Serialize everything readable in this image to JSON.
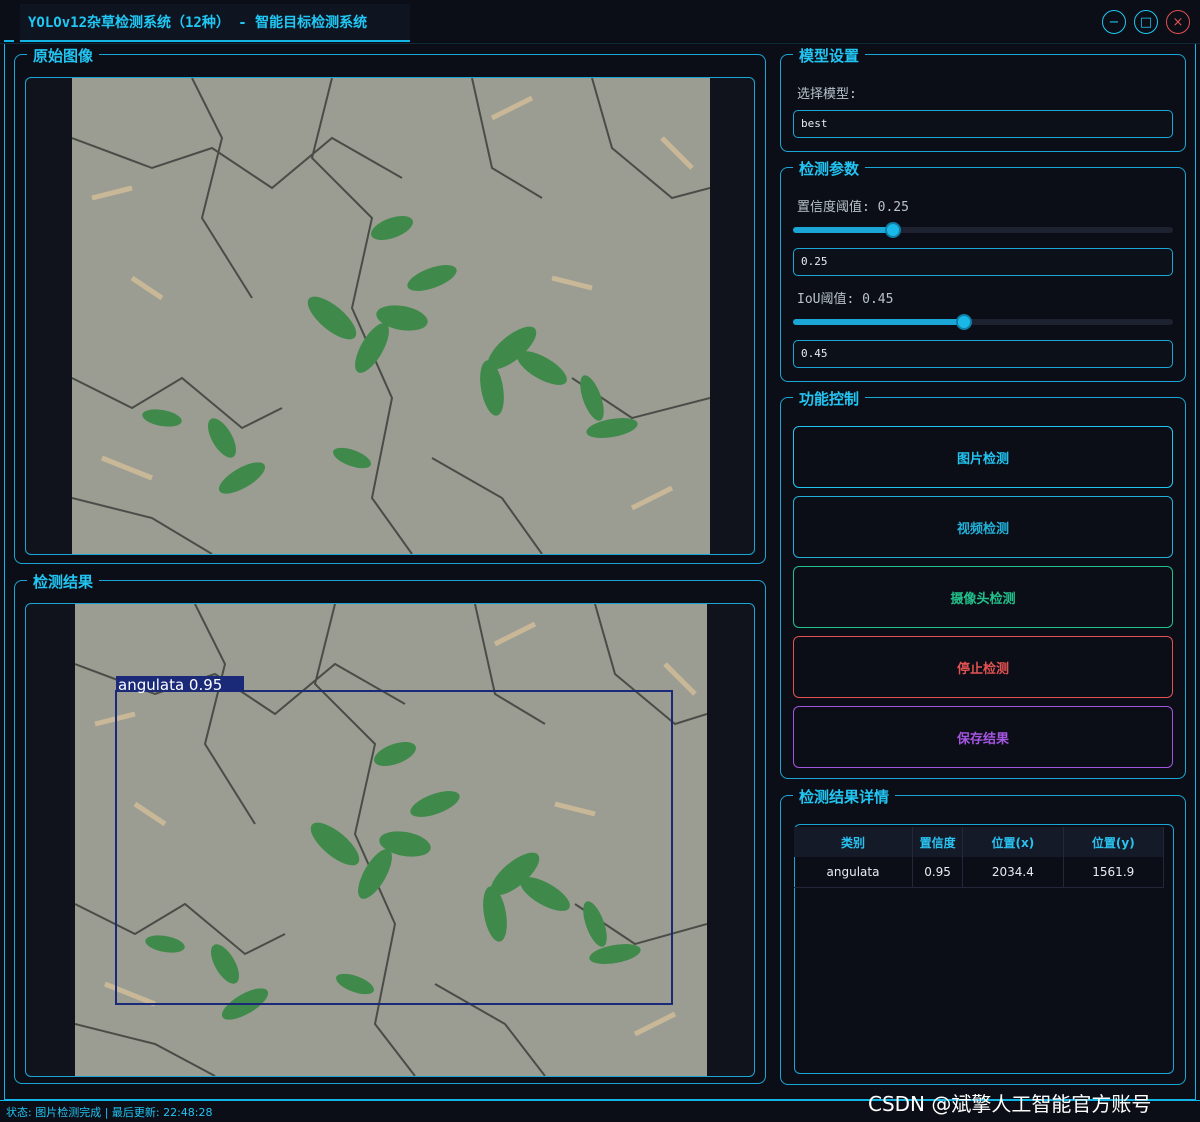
{
  "window": {
    "title": "YOLOv12杂草检测系统（12种） - 智能目标检测系统",
    "controls": {
      "minimize": "−",
      "maximize": "□",
      "close": "×"
    }
  },
  "original_panel": {
    "title": "原始图像"
  },
  "result_panel": {
    "title": "检测结果",
    "detection": {
      "label": "angulata 0.95",
      "class": "angulata",
      "confidence": 0.95
    }
  },
  "model_settings": {
    "title": "模型设置",
    "select_label": "选择模型:",
    "selected_model": "best"
  },
  "detection_params": {
    "title": "检测参数",
    "confidence_label": "置信度阈值: 0.25",
    "confidence_value": "0.25",
    "confidence_fraction": 0.25,
    "iou_label": "IoU阈值: 0.45",
    "iou_value": "0.45",
    "iou_fraction": 0.45
  },
  "function_control": {
    "title": "功能控制",
    "buttons": [
      {
        "label": "图片检测",
        "color": "#22c4f2"
      },
      {
        "label": "视频检测",
        "color": "#22b0d8"
      },
      {
        "label": "摄像头检测",
        "color": "#22c08a"
      },
      {
        "label": "停止检测",
        "color": "#e25252"
      },
      {
        "label": "保存结果",
        "color": "#a455e0"
      }
    ]
  },
  "results_detail": {
    "title": "检测结果详情",
    "columns": [
      "类别",
      "置信度",
      "位置(x)",
      "位置(y)"
    ],
    "rows": [
      [
        "angulata",
        "0.95",
        "2034.4",
        "1561.9"
      ]
    ]
  },
  "status_bar": {
    "text": "状态: 图片检测完成 | 最后更新: 22:48:28"
  },
  "watermark": {
    "text": "CSDN @斌擎人工智能官方账号"
  },
  "colors": {
    "accent": "#1aa7d8",
    "background": "#0b0e16",
    "box": "#1a2a78"
  }
}
